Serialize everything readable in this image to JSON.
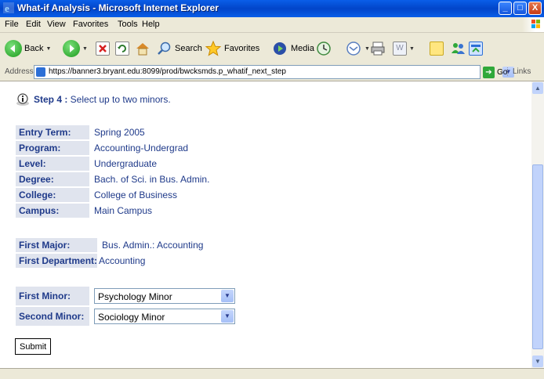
{
  "window": {
    "title": "What-if Analysis - Microsoft Internet Explorer",
    "controls": {
      "minimize": "_",
      "maximize": "□",
      "close": "X"
    }
  },
  "menu": [
    "File",
    "Edit",
    "View",
    "Favorites",
    "Tools",
    "Help"
  ],
  "toolbar": {
    "back_label": "Back",
    "search_label": "Search",
    "favorites_label": "Favorites",
    "media_label": "Media"
  },
  "address": {
    "label": "Address",
    "url": "https://banner3.bryant.edu:8099/prod/bwcksmds.p_whatif_next_step",
    "go_label": "Go",
    "links_label": "Links"
  },
  "page": {
    "step_number": "Step 4 :",
    "step_text": " Select up to two minors.",
    "program_info": [
      {
        "label": "Entry Term:",
        "value": "Spring 2005"
      },
      {
        "label": "Program:",
        "value": "Accounting-Undergrad"
      },
      {
        "label": "Level:",
        "value": "Undergraduate"
      },
      {
        "label": "Degree:",
        "value": "Bach. of Sci. in Bus. Admin."
      },
      {
        "label": "College:",
        "value": "College of Business"
      },
      {
        "label": "Campus:",
        "value": "Main Campus"
      }
    ],
    "major_info": [
      {
        "label": "First Major:",
        "value": "Bus. Admin.: Accounting"
      },
      {
        "label": "First Department:",
        "value": "Accounting"
      }
    ],
    "minors": [
      {
        "label": "First Minor:",
        "selected": "Psychology Minor"
      },
      {
        "label": "Second Minor:",
        "selected": "Sociology Minor"
      }
    ],
    "submit_label": "Submit"
  },
  "colors": {
    "label_bg": "#e0e4ee",
    "text_blue": "#1f3a8a",
    "titlebar": "#0a5ee8"
  }
}
